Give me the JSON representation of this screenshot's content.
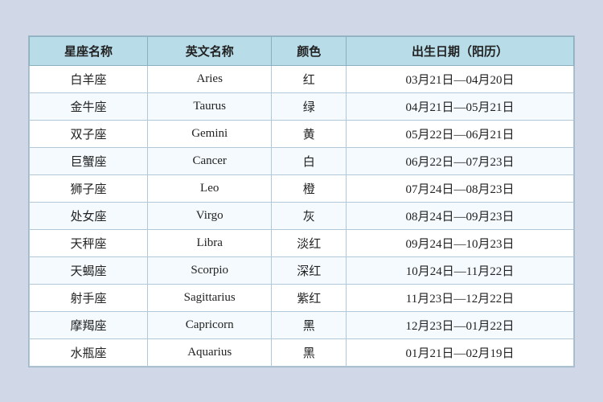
{
  "table": {
    "headers": [
      "星座名称",
      "英文名称",
      "颜色",
      "出生日期（阳历）"
    ],
    "rows": [
      [
        "白羊座",
        "Aries",
        "红",
        "03月21日—04月20日"
      ],
      [
        "金牛座",
        "Taurus",
        "绿",
        "04月21日—05月21日"
      ],
      [
        "双子座",
        "Gemini",
        "黄",
        "05月22日—06月21日"
      ],
      [
        "巨蟹座",
        "Cancer",
        "白",
        "06月22日—07月23日"
      ],
      [
        "狮子座",
        "Leo",
        "橙",
        "07月24日—08月23日"
      ],
      [
        "处女座",
        "Virgo",
        "灰",
        "08月24日—09月23日"
      ],
      [
        "天秤座",
        "Libra",
        "淡红",
        "09月24日—10月23日"
      ],
      [
        "天蝎座",
        "Scorpio",
        "深红",
        "10月24日—11月22日"
      ],
      [
        "射手座",
        "Sagittarius",
        "紫红",
        "11月23日—12月22日"
      ],
      [
        "摩羯座",
        "Capricorn",
        "黑",
        "12月23日—01月22日"
      ],
      [
        "水瓶座",
        "Aquarius",
        "黑",
        "01月21日—02月19日"
      ]
    ]
  }
}
